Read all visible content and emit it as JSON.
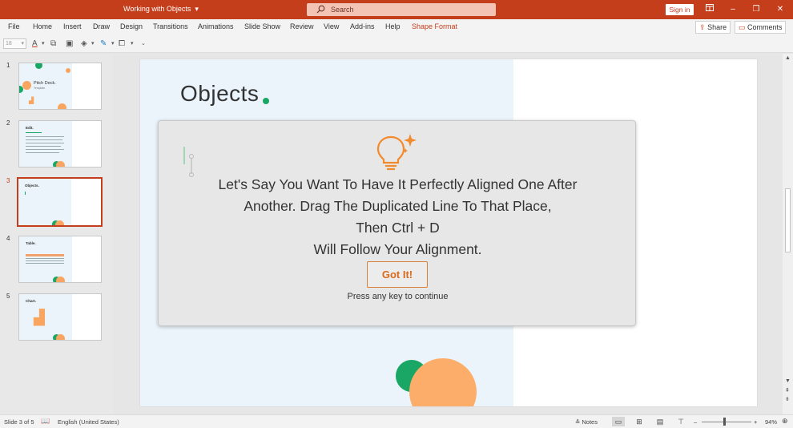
{
  "titlebar": {
    "doc_title": "Working with Objects",
    "search_placeholder": "Search",
    "signin_label": "Sign in",
    "minimize": "–",
    "restore": "❐",
    "close": "✕"
  },
  "menu": {
    "items": [
      "File",
      "Home",
      "Insert",
      "Draw",
      "Design",
      "Transitions",
      "Animations",
      "Slide Show",
      "Review",
      "View",
      "Add-ins",
      "Help",
      "Shape Format"
    ],
    "active_item": "Shape Format",
    "share_label": "Share",
    "comments_label": "Comments"
  },
  "toolbar": {
    "font_size": "18"
  },
  "thumbnails": [
    {
      "number": "1",
      "title": "Pitch Deck.",
      "subtitle": "Template"
    },
    {
      "number": "2",
      "title": "Edit."
    },
    {
      "number": "3",
      "title": "Objects.",
      "selected": true
    },
    {
      "number": "4",
      "title": "Table."
    },
    {
      "number": "5",
      "title": "Chart."
    }
  ],
  "slide": {
    "title": "Objects"
  },
  "tip": {
    "lines": [
      "Let's Say You Want To Have It Perfectly Aligned One After",
      "Another. Drag The Duplicated Line To That Place,",
      "Then Ctrl + D",
      "Will Follow Your Alignment."
    ],
    "button_label": "Got It!",
    "hint": "Press any key to continue"
  },
  "statusbar": {
    "slide_info": "Slide 3 of 5",
    "language": "English (United States)",
    "notes_label": "Notes",
    "zoom_minus": "–",
    "zoom_plus": "+",
    "zoom_level": "94%"
  },
  "colors": {
    "accent": "#c43e1c",
    "green": "#1aa664",
    "orange": "#fdad6a"
  }
}
